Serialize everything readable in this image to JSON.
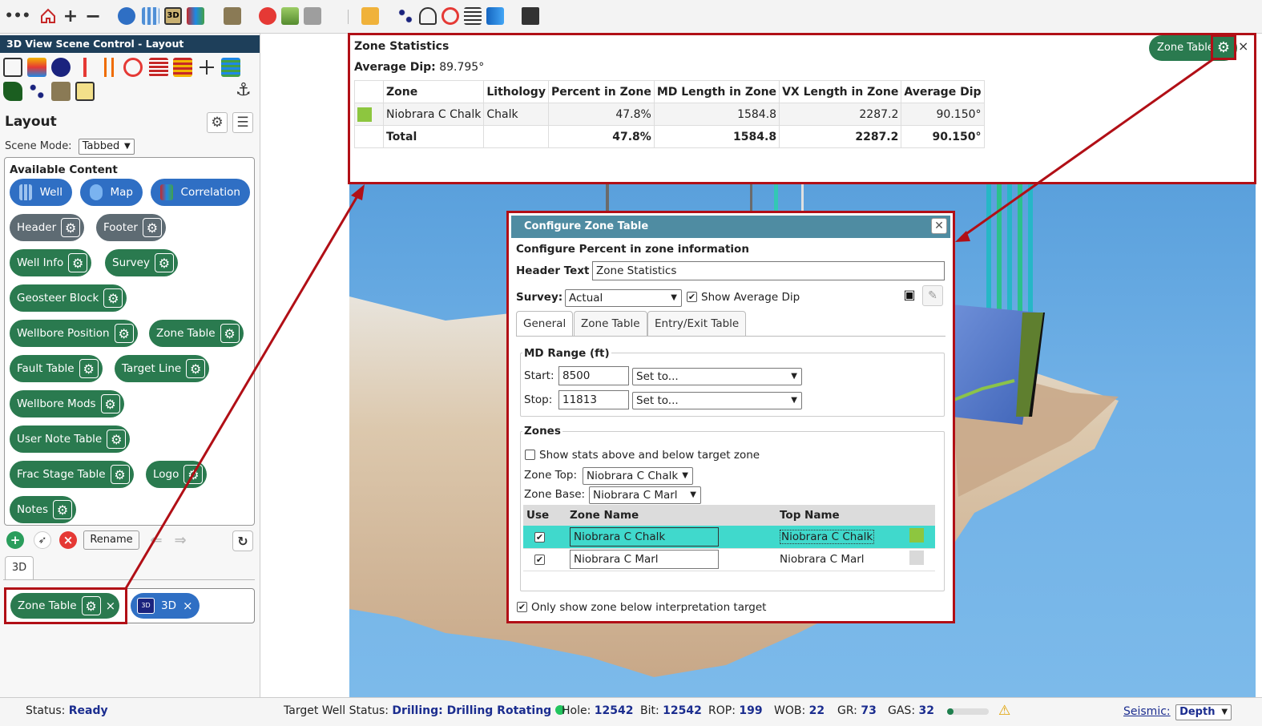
{
  "toolbar": {
    "icons": [
      "more-icon",
      "home-icon",
      "zoom-in-icon",
      "zoom-out-icon",
      "compass-icon",
      "well-grid-icon",
      "3d-icon",
      "correlation-icon",
      "geosteer-icon",
      "survey-icon",
      "cube-icon",
      "camera-icon",
      "info-icon",
      "ruler-icon",
      "points-icon",
      "bell-icon",
      "target-icon",
      "layers-icon",
      "arrow-icon",
      "print-icon"
    ]
  },
  "left_panel": {
    "title": "3D View Scene Control - Layout",
    "layout_heading": "Layout",
    "scene_mode_label": "Scene Mode:",
    "scene_mode_value": "Tabbed",
    "available_heading": "Available Content",
    "content_items": [
      {
        "label": "Well",
        "style": "blue"
      },
      {
        "label": "Map",
        "style": "blue"
      },
      {
        "label": "Correlation",
        "style": "blue"
      },
      {
        "label": "Header",
        "style": "gray"
      },
      {
        "label": "Footer",
        "style": "gray"
      },
      {
        "label": "Well Info",
        "style": "green"
      },
      {
        "label": "Survey",
        "style": "green"
      },
      {
        "label": "Geosteer Block",
        "style": "green"
      },
      {
        "label": "Wellbore Position",
        "style": "green"
      },
      {
        "label": "Zone Table",
        "style": "green"
      },
      {
        "label": "Fault Table",
        "style": "green"
      },
      {
        "label": "Target Line",
        "style": "green"
      },
      {
        "label": "Wellbore Mods",
        "style": "green"
      },
      {
        "label": "User Note Table",
        "style": "green"
      },
      {
        "label": "Frac Stage Table",
        "style": "green"
      },
      {
        "label": "Logo",
        "style": "green"
      },
      {
        "label": "Notes",
        "style": "green"
      }
    ],
    "rename_label": "Rename",
    "tab_label": "3D",
    "active_items": [
      {
        "label": "Zone Table"
      },
      {
        "label": "3D"
      }
    ]
  },
  "zone_stats": {
    "title": "Zone Statistics",
    "avg_dip_label": "Average Dip:",
    "avg_dip_value": "89.795°",
    "columns": [
      "Zone",
      "Lithology",
      "Percent in Zone",
      "MD Length in Zone",
      "VX Length in Zone",
      "Average Dip"
    ],
    "row": {
      "zone": "Niobrara C Chalk",
      "lithology": "Chalk",
      "percent": "47.8%",
      "md": "1584.8",
      "vx": "2287.2",
      "dip": "90.150°"
    },
    "total": {
      "label": "Total",
      "percent": "47.8%",
      "md": "1584.8",
      "vx": "2287.2",
      "dip": "90.150°"
    },
    "badge_label": "Zone Table"
  },
  "dialog": {
    "title": "Configure Zone Table",
    "subtitle": "Configure Percent in zone information",
    "header_text_label": "Header Text",
    "header_text_value": "Zone Statistics",
    "survey_label": "Survey:",
    "survey_value": "Actual",
    "show_avg_dip_label": "Show Average Dip",
    "tabs": [
      "General",
      "Zone Table",
      "Entry/Exit Table"
    ],
    "md_range_label": "MD Range (ft)",
    "start_label": "Start:",
    "start_value": "8500",
    "stop_label": "Stop:",
    "stop_value": "11813",
    "set_to_label": "Set to...",
    "zones_label": "Zones",
    "show_stats_label": "Show stats above and below target zone",
    "zone_top_label": "Zone Top:",
    "zone_top_value": "Niobrara C Chalk",
    "zone_base_label": "Zone Base:",
    "zone_base_value": "Niobrara C Marl",
    "grid_columns": [
      "Use",
      "Zone Name",
      "Top Name"
    ],
    "grid_rows": [
      {
        "zone": "Niobrara C Chalk",
        "top": "Niobrara C Chalk",
        "color": "#8dc63f"
      },
      {
        "zone": "Niobrara C Marl",
        "top": "Niobrara C Marl",
        "color": "#d9d9d9"
      }
    ],
    "only_show_label": "Only show zone below interpretation target"
  },
  "status": {
    "status_label": "Status:",
    "status_value": "Ready",
    "target_label": "Target Well Status:",
    "target_value": "Drilling: Drilling Rotating",
    "hole_label": "Hole:",
    "hole_value": "12542",
    "bit_label": "Bit:",
    "bit_value": "12542",
    "rop_label": "ROP:",
    "rop_value": "199",
    "wob_label": "WOB:",
    "wob_value": "22",
    "gr_label": "GR:",
    "gr_value": "73",
    "gas_label": "GAS:",
    "gas_value": "32",
    "gas_level": 0.15,
    "seismic_label": "Seismic:",
    "seismic_value": "Depth"
  },
  "colors": {
    "highlight": "#b10f16",
    "green_pill": "#2a7a4f",
    "blue_pill": "#2f6fc4",
    "dialog_header": "#4f8ca2",
    "status_ok": "#22c55e",
    "zone_chalk": "#8dc63f"
  }
}
